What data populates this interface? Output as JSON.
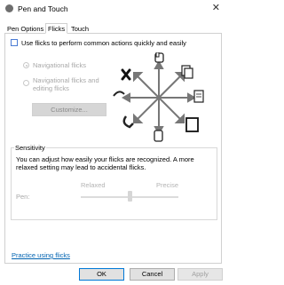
{
  "window": {
    "title": "Pen and Touch",
    "close_label": "✕"
  },
  "tabs": [
    {
      "label": "Pen Options",
      "active": false
    },
    {
      "label": "Flicks",
      "active": true
    },
    {
      "label": "Touch",
      "active": false
    }
  ],
  "flicks": {
    "use_flicks_label": "Use flicks to perform common actions quickly and easily",
    "use_flicks_checked": false,
    "options": [
      {
        "label": "Navigational flicks",
        "selected": true
      },
      {
        "label": "Navigational flicks and editing flicks",
        "selected": false
      }
    ],
    "customize_label": "Customize..."
  },
  "sensitivity": {
    "legend": "Sensitivity",
    "description": "You can adjust how easily your flicks are recognized. A more relaxed setting may lead to accidental flicks.",
    "relaxed_label": "Relaxed",
    "precise_label": "Precise",
    "pen_label": "Pen:",
    "slider_value": 0.5
  },
  "practice_link": "Practice using flicks",
  "buttons": {
    "ok": "OK",
    "cancel": "Cancel",
    "apply": "Apply"
  },
  "colors": {
    "accent": "#0078d7",
    "link": "#0063b1",
    "checkbox_border": "#4a7bd4"
  }
}
